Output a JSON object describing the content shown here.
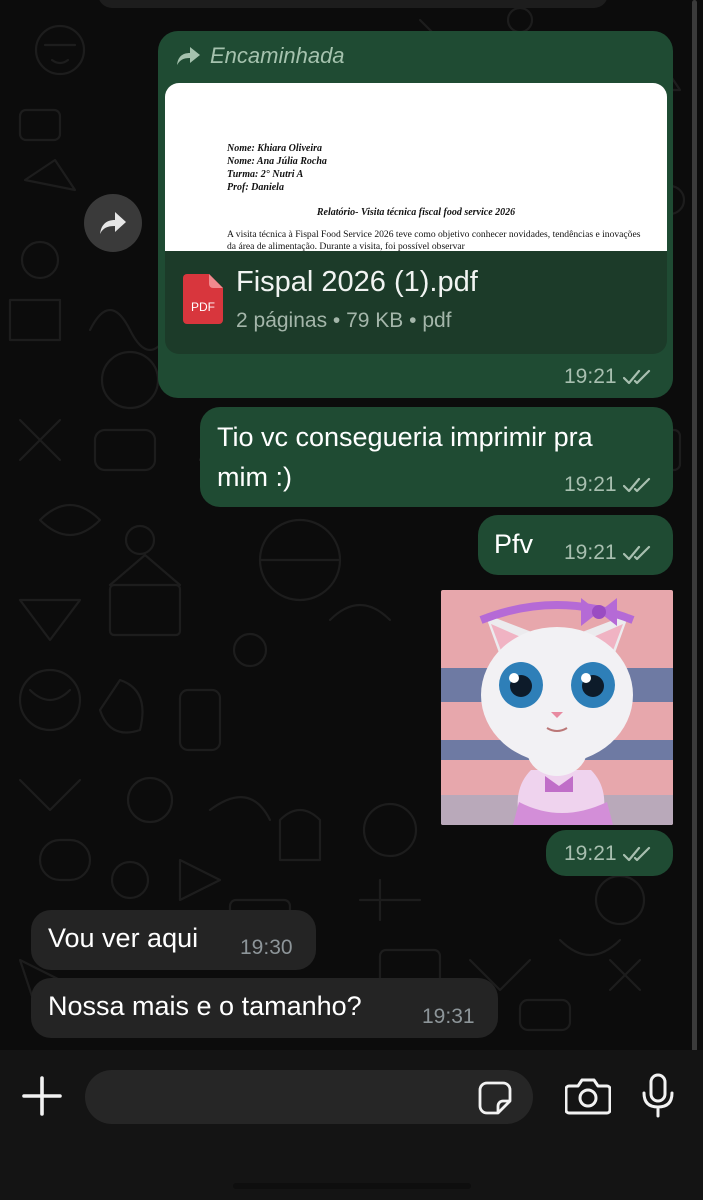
{
  "messages": {
    "forwarded_doc": {
      "forward_label": "Encaminhada",
      "doc_preview": {
        "lines": [
          "Nome: Khiara Oliveira",
          "Nome: Ana Júlia Rocha",
          "Turma: 2° Nutri A",
          "Prof: Daniela"
        ],
        "title": "Relatório- Visita técnica fiscal food service 2026",
        "body": "A visita técnica à Fispal Food Service 2026 teve como objetivo conhecer novidades, tendências e inovações da área de alimentação. Durante a visita, foi possível observar"
      },
      "pdf_badge": "PDF",
      "file_name": "Fispal 2026 (1).pdf",
      "file_info": "2 páginas • 79 KB • pdf",
      "time": "19:21"
    },
    "msg1": {
      "text_line1": "Tio vc consegueria imprimir pra",
      "text_line2": "mim :)",
      "time": "19:21"
    },
    "msg2": {
      "text": "Pfv",
      "time": "19:21"
    },
    "sticker": {
      "icon": "cat-sticker",
      "time": "19:21"
    },
    "msg3": {
      "text": "Vou ver aqui",
      "time": "19:30"
    },
    "msg4": {
      "text": "Nossa mais e o tamanho?",
      "time": "19:31"
    }
  },
  "composer": {
    "icons": [
      "plus-icon",
      "sticker-icon",
      "camera-icon",
      "mic-icon"
    ]
  },
  "colors": {
    "outgoing_bubble": "#1f4b33",
    "incoming_bubble": "#242424",
    "read_ticks": "#a8bfb0",
    "pdf_red": "#d8363d"
  }
}
